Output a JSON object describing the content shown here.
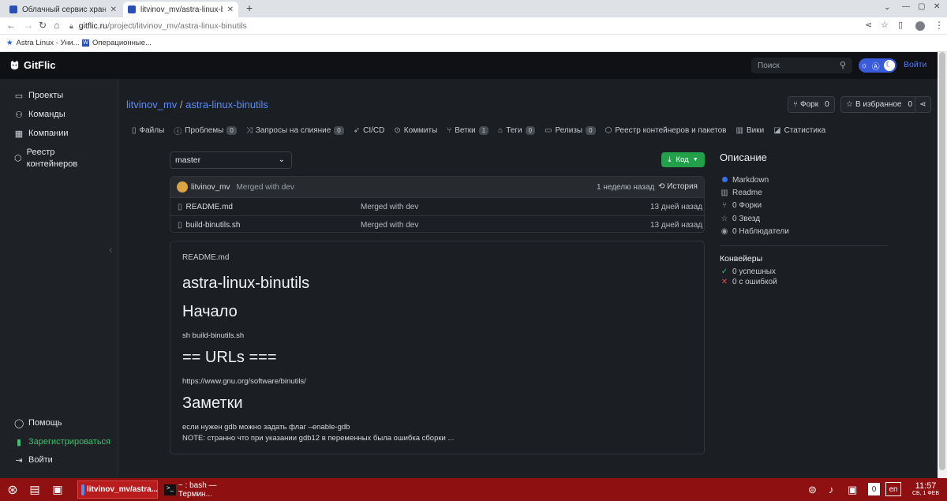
{
  "browser": {
    "tabs": [
      {
        "label": "Облачный сервис хранения",
        "active": false
      },
      {
        "label": "litvinov_mv/astra-linux-binutils",
        "active": true
      }
    ],
    "new_tab": "+",
    "url_host": "gitflic.ru",
    "url_path": "/project/litvinov_mv/astra-linux-binutils",
    "bookmarks": [
      "Astra Linux - Уни...",
      "Операционные..."
    ]
  },
  "header": {
    "logo": "GitFlic",
    "search_placeholder": "Поиск",
    "login": "Войти"
  },
  "sidebar": {
    "items": [
      {
        "label": "Проекты",
        "icon": "folder-icon"
      },
      {
        "label": "Команды",
        "icon": "team-icon"
      },
      {
        "label": "Компании",
        "icon": "building-icon"
      },
      {
        "label": "Реестр контейнеров",
        "icon": "cube-icon"
      }
    ],
    "bottom": [
      {
        "label": "Помощь",
        "icon": "help-icon"
      },
      {
        "label": "Зарегистрироваться",
        "icon": "register-icon",
        "color": "#3cc46a"
      },
      {
        "label": "Войти",
        "icon": "login-icon"
      }
    ]
  },
  "repo": {
    "owner": "litvinov_mv",
    "sep": "/",
    "name": "astra-linux-binutils",
    "fork_label": "Форк",
    "fork_count": "0",
    "fav_label": "В избранное",
    "fav_count": "0"
  },
  "tabs": [
    {
      "label": "Файлы",
      "count": null
    },
    {
      "label": "Проблемы",
      "count": "0"
    },
    {
      "label": "Запросы на слияние",
      "count": "0"
    },
    {
      "label": "CI/CD",
      "count": null
    },
    {
      "label": "Коммиты",
      "count": null
    },
    {
      "label": "Ветки",
      "count": "1"
    },
    {
      "label": "Теги",
      "count": "0"
    },
    {
      "label": "Релизы",
      "count": "0"
    },
    {
      "label": "Реестр контейнеров и пакетов",
      "count": null
    },
    {
      "label": "Вики",
      "count": null
    },
    {
      "label": "Статистика",
      "count": null
    }
  ],
  "branch": "master",
  "code_button": "Код",
  "commit": {
    "author": "litvinov_mv",
    "message": "Merged with dev",
    "time": "1 неделю назад",
    "history": "История"
  },
  "files": [
    {
      "name": "README.md",
      "message": "Merged with dev",
      "time": "13 дней назад"
    },
    {
      "name": "build-binutils.sh",
      "message": "Merged with dev",
      "time": "13 дней назад"
    }
  ],
  "readme": {
    "filename": "README.md",
    "h1": "astra-linux-binutils",
    "h_start": "Начало",
    "cmd": "sh build-binutils.sh",
    "h_urls": "== URLs ===",
    "url": "https://www.gnu.org/software/binutils/",
    "h_notes": "Заметки",
    "note1": "если нужен gdb можно задать флаг –enable-gdb",
    "note2": "NOTE: странно что при указании gdb12 в переменных была ошибка сборки ..."
  },
  "about": {
    "title": "Описание",
    "language": "Markdown",
    "language_color": "#3a6ff0",
    "readme": "Readme",
    "forks": "0 Форки",
    "stars": "0 Звезд",
    "watchers": "0 Наблюдатели",
    "pipelines_title": "Конвейеры",
    "success": "0 успешных",
    "failed": "0 с ошибкой"
  },
  "taskbar": {
    "window1": "litvinov_mv/astra...",
    "window2": "~ : bash — Термин...",
    "badge": "0",
    "lang": "en",
    "time": "11:57",
    "date": "СБ, 1 ФЕВ"
  }
}
